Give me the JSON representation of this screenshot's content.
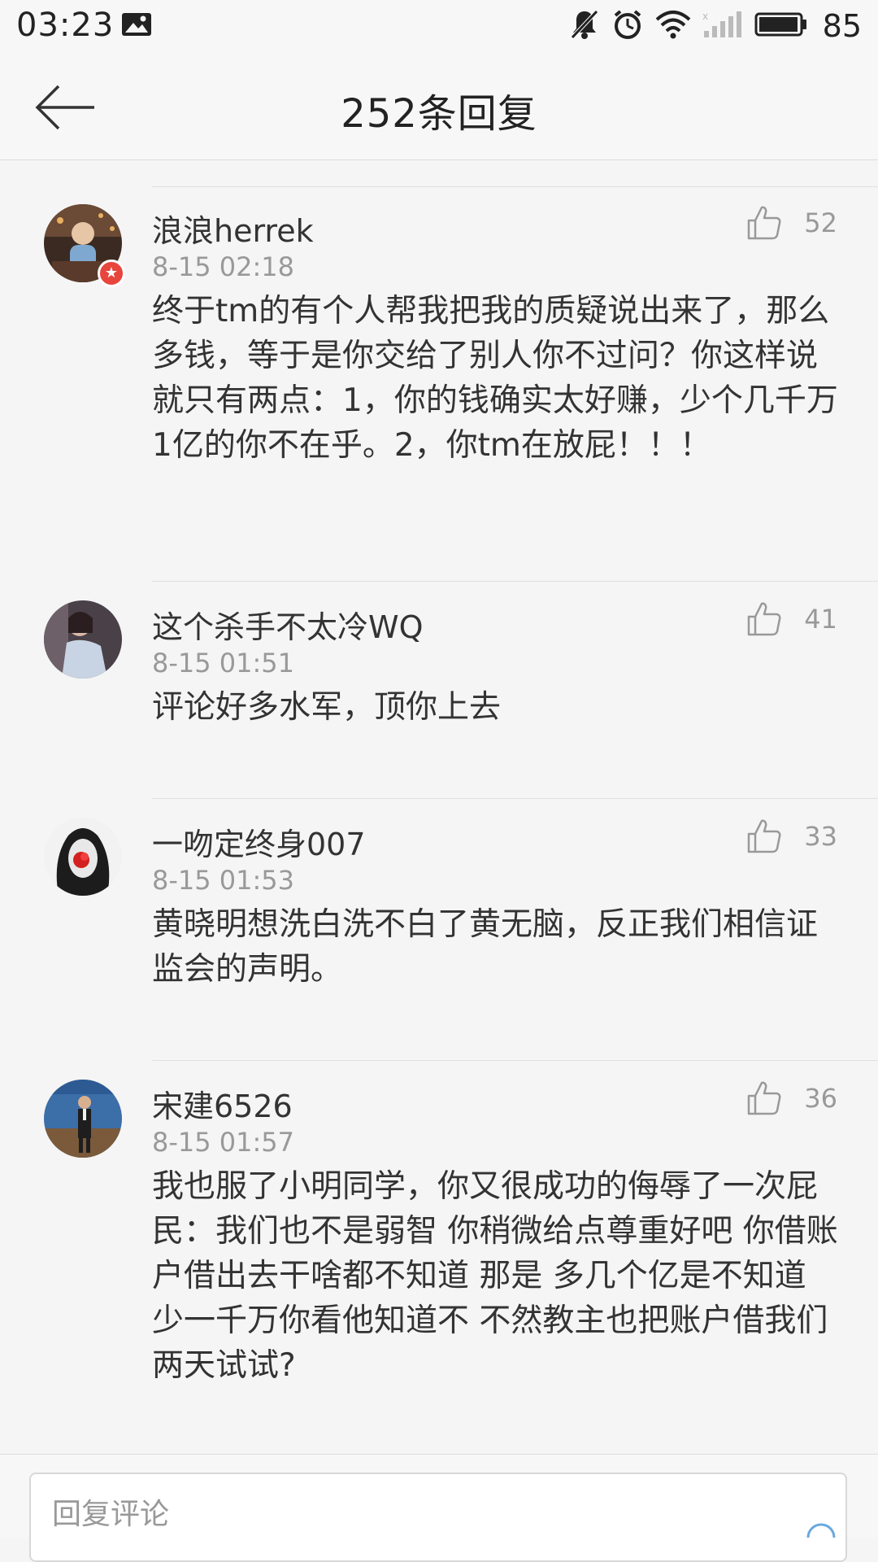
{
  "status_bar": {
    "time": "03:23",
    "battery": "85",
    "icons": [
      "image-notification-icon",
      "mute-icon",
      "alarm-icon",
      "wifi-icon",
      "signal-icon",
      "battery-icon"
    ]
  },
  "header": {
    "title": "252条回复",
    "back_icon": "arrow-left-icon"
  },
  "comments": [
    {
      "username": "浪浪herrek",
      "time": "8-15 02:18",
      "likes": "52",
      "text": "终于tm的有个人帮我把我的质疑说出来了，那么多钱，等于是你交给了别人你不过问？你这样说就只有两点：1，你的钱确实太好赚，少个几千万1亿的你不在乎。2，你tm在放屁！！！",
      "verified_badge": true
    },
    {
      "username": "这个杀手不太冷WQ",
      "time": "8-15 01:51",
      "likes": "41",
      "text": "评论好多水军，顶你上去",
      "verified_badge": false
    },
    {
      "username": "一吻定终身007",
      "time": "8-15 01:53",
      "likes": "33",
      "text": "黄晓明想洗白洗不白了黄无脑，反正我们相信证监会的声明。",
      "verified_badge": false
    },
    {
      "username": "宋建6526",
      "time": "8-15 01:57",
      "likes": "36",
      "text": "我也服了小明同学，你又很成功的侮辱了一次屁民：我们也不是弱智 你稍微给点尊重好吧 你借账户借出去干啥都不知道 那是  多几个亿是不知道  少一千万你看他知道不 不然教主也把账户借我们两天试试?",
      "verified_badge": false
    }
  ],
  "reply_bar": {
    "placeholder": "回复评论"
  },
  "colors": {
    "background": "#f5f5f5",
    "text": "#333333",
    "secondary_text": "#999999",
    "divider": "#e0e0e0",
    "badge": "#e8453c"
  }
}
